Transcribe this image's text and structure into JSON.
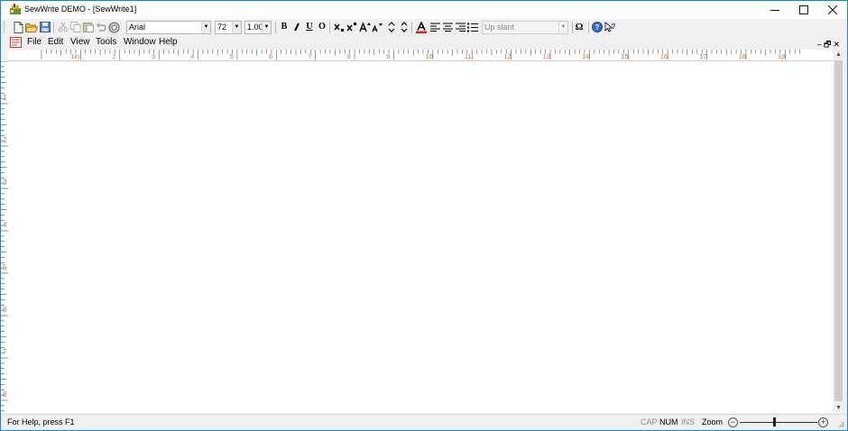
{
  "window": {
    "title": "SewWrite DEMO - [SewWrite1]",
    "accent": "#1883d7"
  },
  "toolbar": {
    "font_name": "Arial",
    "font_size": "72",
    "spacing": "1.00",
    "bold_label": "B",
    "underline_label": "U",
    "outline_label": "O",
    "style_placeholder": "Up slant",
    "omega_label": "Ω",
    "icons": [
      "new-file-icon",
      "open-folder-icon",
      "save-icon",
      "cut-icon",
      "copy-icon",
      "paste-icon",
      "undo-icon",
      "print-icon",
      "italic-icon",
      "subscript-icon",
      "superscript-icon",
      "grow-font-icon",
      "shrink-font-icon",
      "spacing-up-down-icon",
      "font-color-icon",
      "align-left-icon",
      "align-center-icon",
      "align-right-icon",
      "list-icon",
      "help-icon",
      "context-help-icon"
    ]
  },
  "menu": {
    "items": [
      "File",
      "Edit",
      "View",
      "Tools",
      "Window",
      "Help"
    ]
  },
  "ruler": {
    "h_labels": [
      "1in",
      "2",
      "3",
      "4",
      "5",
      "6",
      "7",
      "8",
      "9",
      "10",
      "11",
      "12",
      "13",
      "14",
      "15",
      "16",
      "17",
      "18",
      "19"
    ],
    "v_labels": [
      "1",
      "2",
      "3",
      "4",
      "5",
      "6",
      "7",
      "8"
    ],
    "label_color": "#c8733a"
  },
  "status": {
    "help_text": "For Help, press F1",
    "cap": "CAP",
    "num": "NUM",
    "ins": "INS",
    "zoom_label": "Zoom",
    "zoom_minus": "−",
    "zoom_plus": "+",
    "zoom_level": 0.45
  }
}
